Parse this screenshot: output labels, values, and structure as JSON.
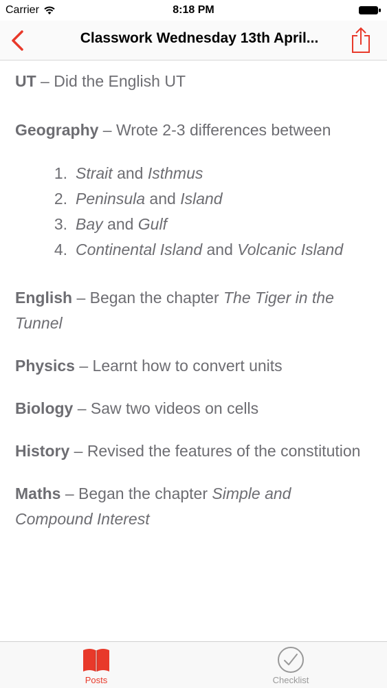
{
  "status_bar": {
    "carrier": "Carrier",
    "time": "8:18 PM"
  },
  "nav": {
    "title": "Classwork Wednesday 13th April..."
  },
  "entries": {
    "ut": {
      "subject": "UT",
      "text": " – Did the English UT"
    },
    "geography": {
      "subject": "Geography",
      "text": " – Wrote 2-3 differences between",
      "items": [
        {
          "num": "1.",
          "a": "Strait",
          "and": " and ",
          "b": "Isthmus"
        },
        {
          "num": "2.",
          "a": "Peninsula",
          "and": " and ",
          "b": "Island"
        },
        {
          "num": "3.",
          "a": "Bay",
          "and": " and ",
          "b": "Gulf"
        },
        {
          "num": "4.",
          "a": "Continental Island",
          "and": " and ",
          "b": "Volcanic Island"
        }
      ]
    },
    "english": {
      "subject": "English",
      "text": " – Began the chapter ",
      "title": "The Tiger in the Tunnel"
    },
    "physics": {
      "subject": "Physics",
      "text": " – Learnt how to convert units"
    },
    "biology": {
      "subject": "Biology",
      "text": " – Saw two videos on cells"
    },
    "history": {
      "subject": "History",
      "text": " – Revised the features of the constitution"
    },
    "maths": {
      "subject": "Maths",
      "text": " – Began the chapter ",
      "title": "Simple and Compound Interest"
    }
  },
  "tabs": {
    "posts": "Posts",
    "checklist": "Checklist"
  },
  "colors": {
    "accent": "#e8392a",
    "text": "#6d6d72",
    "inactive": "#999999"
  },
  "icons": {
    "wifi": "wifi-icon",
    "battery": "battery-icon",
    "back": "chevron-left-icon",
    "share": "share-icon",
    "posts": "book-icon",
    "checklist": "checkmark-circle-icon"
  }
}
